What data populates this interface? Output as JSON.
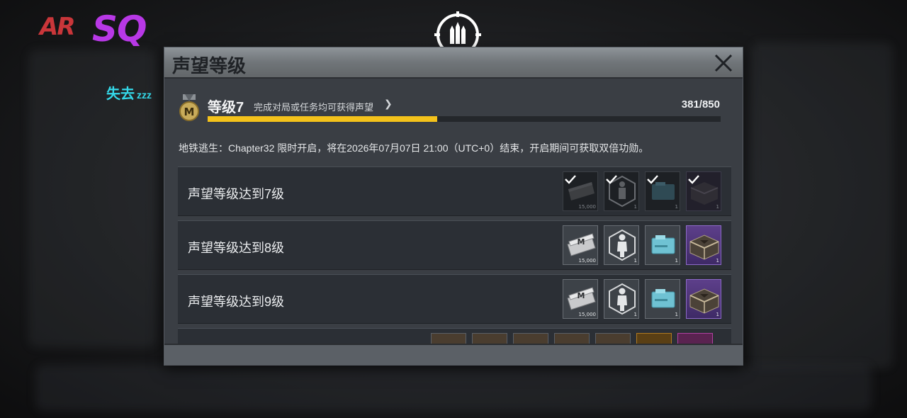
{
  "overlay": {
    "brand_left": "AR",
    "brand_right": "SQ",
    "status_text": "失去",
    "status_suffix": "zzz"
  },
  "dialog": {
    "title": "声望等级",
    "close_icon": "close-icon",
    "level": {
      "label": "等级7",
      "hint": "完成对局或任务均可获得声望",
      "current": 381,
      "max": 850,
      "progress_text": "381/850",
      "progress_fraction": 0.448
    },
    "notice": "地铁逃生：Chapter32 限时开启，将在2026年07月07日 21:00（UTC+0）结束，开启期间可获取双倍功勋。",
    "rewards": [
      {
        "title": "声望等级达到7级",
        "claimed": true,
        "items": [
          {
            "icon": "ticket-icon",
            "count": "15,000"
          },
          {
            "icon": "outfit-icon",
            "count": "1"
          },
          {
            "icon": "rename-card-icon",
            "count": "1"
          },
          {
            "icon": "crate-icon",
            "count": "1",
            "rare": true
          }
        ]
      },
      {
        "title": "声望等级达到8级",
        "claimed": false,
        "items": [
          {
            "icon": "ticket-icon",
            "count": "15,000"
          },
          {
            "icon": "outfit-icon",
            "count": "1"
          },
          {
            "icon": "rename-card-icon",
            "count": "1"
          },
          {
            "icon": "crate-icon",
            "count": "1",
            "rare": true
          }
        ]
      },
      {
        "title": "声望等级达到9级",
        "claimed": false,
        "items": [
          {
            "icon": "ticket-icon",
            "count": "15,000"
          },
          {
            "icon": "outfit-icon",
            "count": "1"
          },
          {
            "icon": "rename-card-icon",
            "count": "1"
          },
          {
            "icon": "crate-icon",
            "count": "1",
            "rare": true
          }
        ]
      }
    ]
  },
  "colors": {
    "progress": "#f4c21b",
    "rare_item": "#5d3f8a",
    "brand_sq": "#b838e6",
    "brand_ar": "#c9363a",
    "status": "#34d8e8"
  }
}
